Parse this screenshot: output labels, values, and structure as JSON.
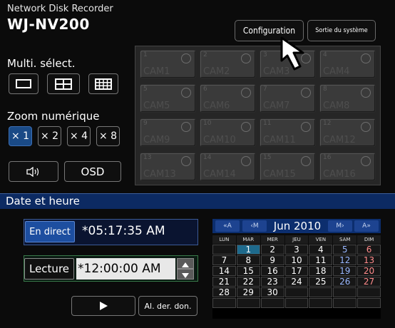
{
  "header": {
    "product": "Network Disk Recorder",
    "model": "WJ-NV200",
    "config_btn": "Configuration",
    "exit_btn": "Sortie du système"
  },
  "left": {
    "multi_label": "Multi. sélect.",
    "layouts": [
      "single-icon",
      "quad-icon",
      "grid9-icon"
    ],
    "zoom_label": "Zoom numérique",
    "zoom_options": [
      "× 1",
      "× 2",
      "× 4",
      "× 8"
    ],
    "zoom_selected": "× 1",
    "osd_btn": "OSD",
    "audio_icon": "speaker-icon"
  },
  "cameras": [
    {
      "num": "1",
      "label": "CAM1"
    },
    {
      "num": "2",
      "label": "CAM2"
    },
    {
      "num": "3",
      "label": "CAM3"
    },
    {
      "num": "4",
      "label": "CAM4"
    },
    {
      "num": "5",
      "label": "CAM5"
    },
    {
      "num": "6",
      "label": "CAM6"
    },
    {
      "num": "7",
      "label": "CAM7"
    },
    {
      "num": "8",
      "label": "CAM8"
    },
    {
      "num": "9",
      "label": "CAM9"
    },
    {
      "num": "10",
      "label": "CAM10"
    },
    {
      "num": "11",
      "label": "CAM11"
    },
    {
      "num": "12",
      "label": "CAM12"
    },
    {
      "num": "13",
      "label": "CAM13"
    },
    {
      "num": "14",
      "label": "CAM14"
    },
    {
      "num": "15",
      "label": "CAM15"
    },
    {
      "num": "16",
      "label": "CAM16"
    }
  ],
  "date": {
    "title": "Date et heure",
    "live_btn": "En direct",
    "live_time": "*05:17:35 AM",
    "play_btn": "Lecture",
    "play_time": "*12:00:00 AM",
    "last_rec_btn": "Al. der. don."
  },
  "calendar": {
    "prev_year": "«A",
    "prev_month": "‹M",
    "month": "Jun 2010",
    "next_month": "M›",
    "next_year": "A»",
    "dow": [
      "LUN",
      "MAR",
      "MER",
      "JEU",
      "VEN",
      "SAM",
      "DIM"
    ],
    "weeks": [
      [
        "",
        "1",
        "2",
        "3",
        "4",
        "5",
        "6"
      ],
      [
        "7",
        "8",
        "9",
        "10",
        "11",
        "12",
        "13"
      ],
      [
        "14",
        "15",
        "16",
        "17",
        "18",
        "19",
        "20"
      ],
      [
        "21",
        "22",
        "23",
        "24",
        "25",
        "26",
        "27"
      ],
      [
        "28",
        "29",
        "30",
        "",
        "",
        "",
        ""
      ],
      [
        "",
        "",
        "",
        "",
        "",
        "",
        ""
      ]
    ],
    "selected_day": "1"
  },
  "colors": {
    "accent": "#1d4ea0",
    "header_bar": "#0c2a62",
    "selected_day": "#1e6a8c",
    "saturday": "#9ab8ff",
    "sunday": "#ff8b8b"
  }
}
